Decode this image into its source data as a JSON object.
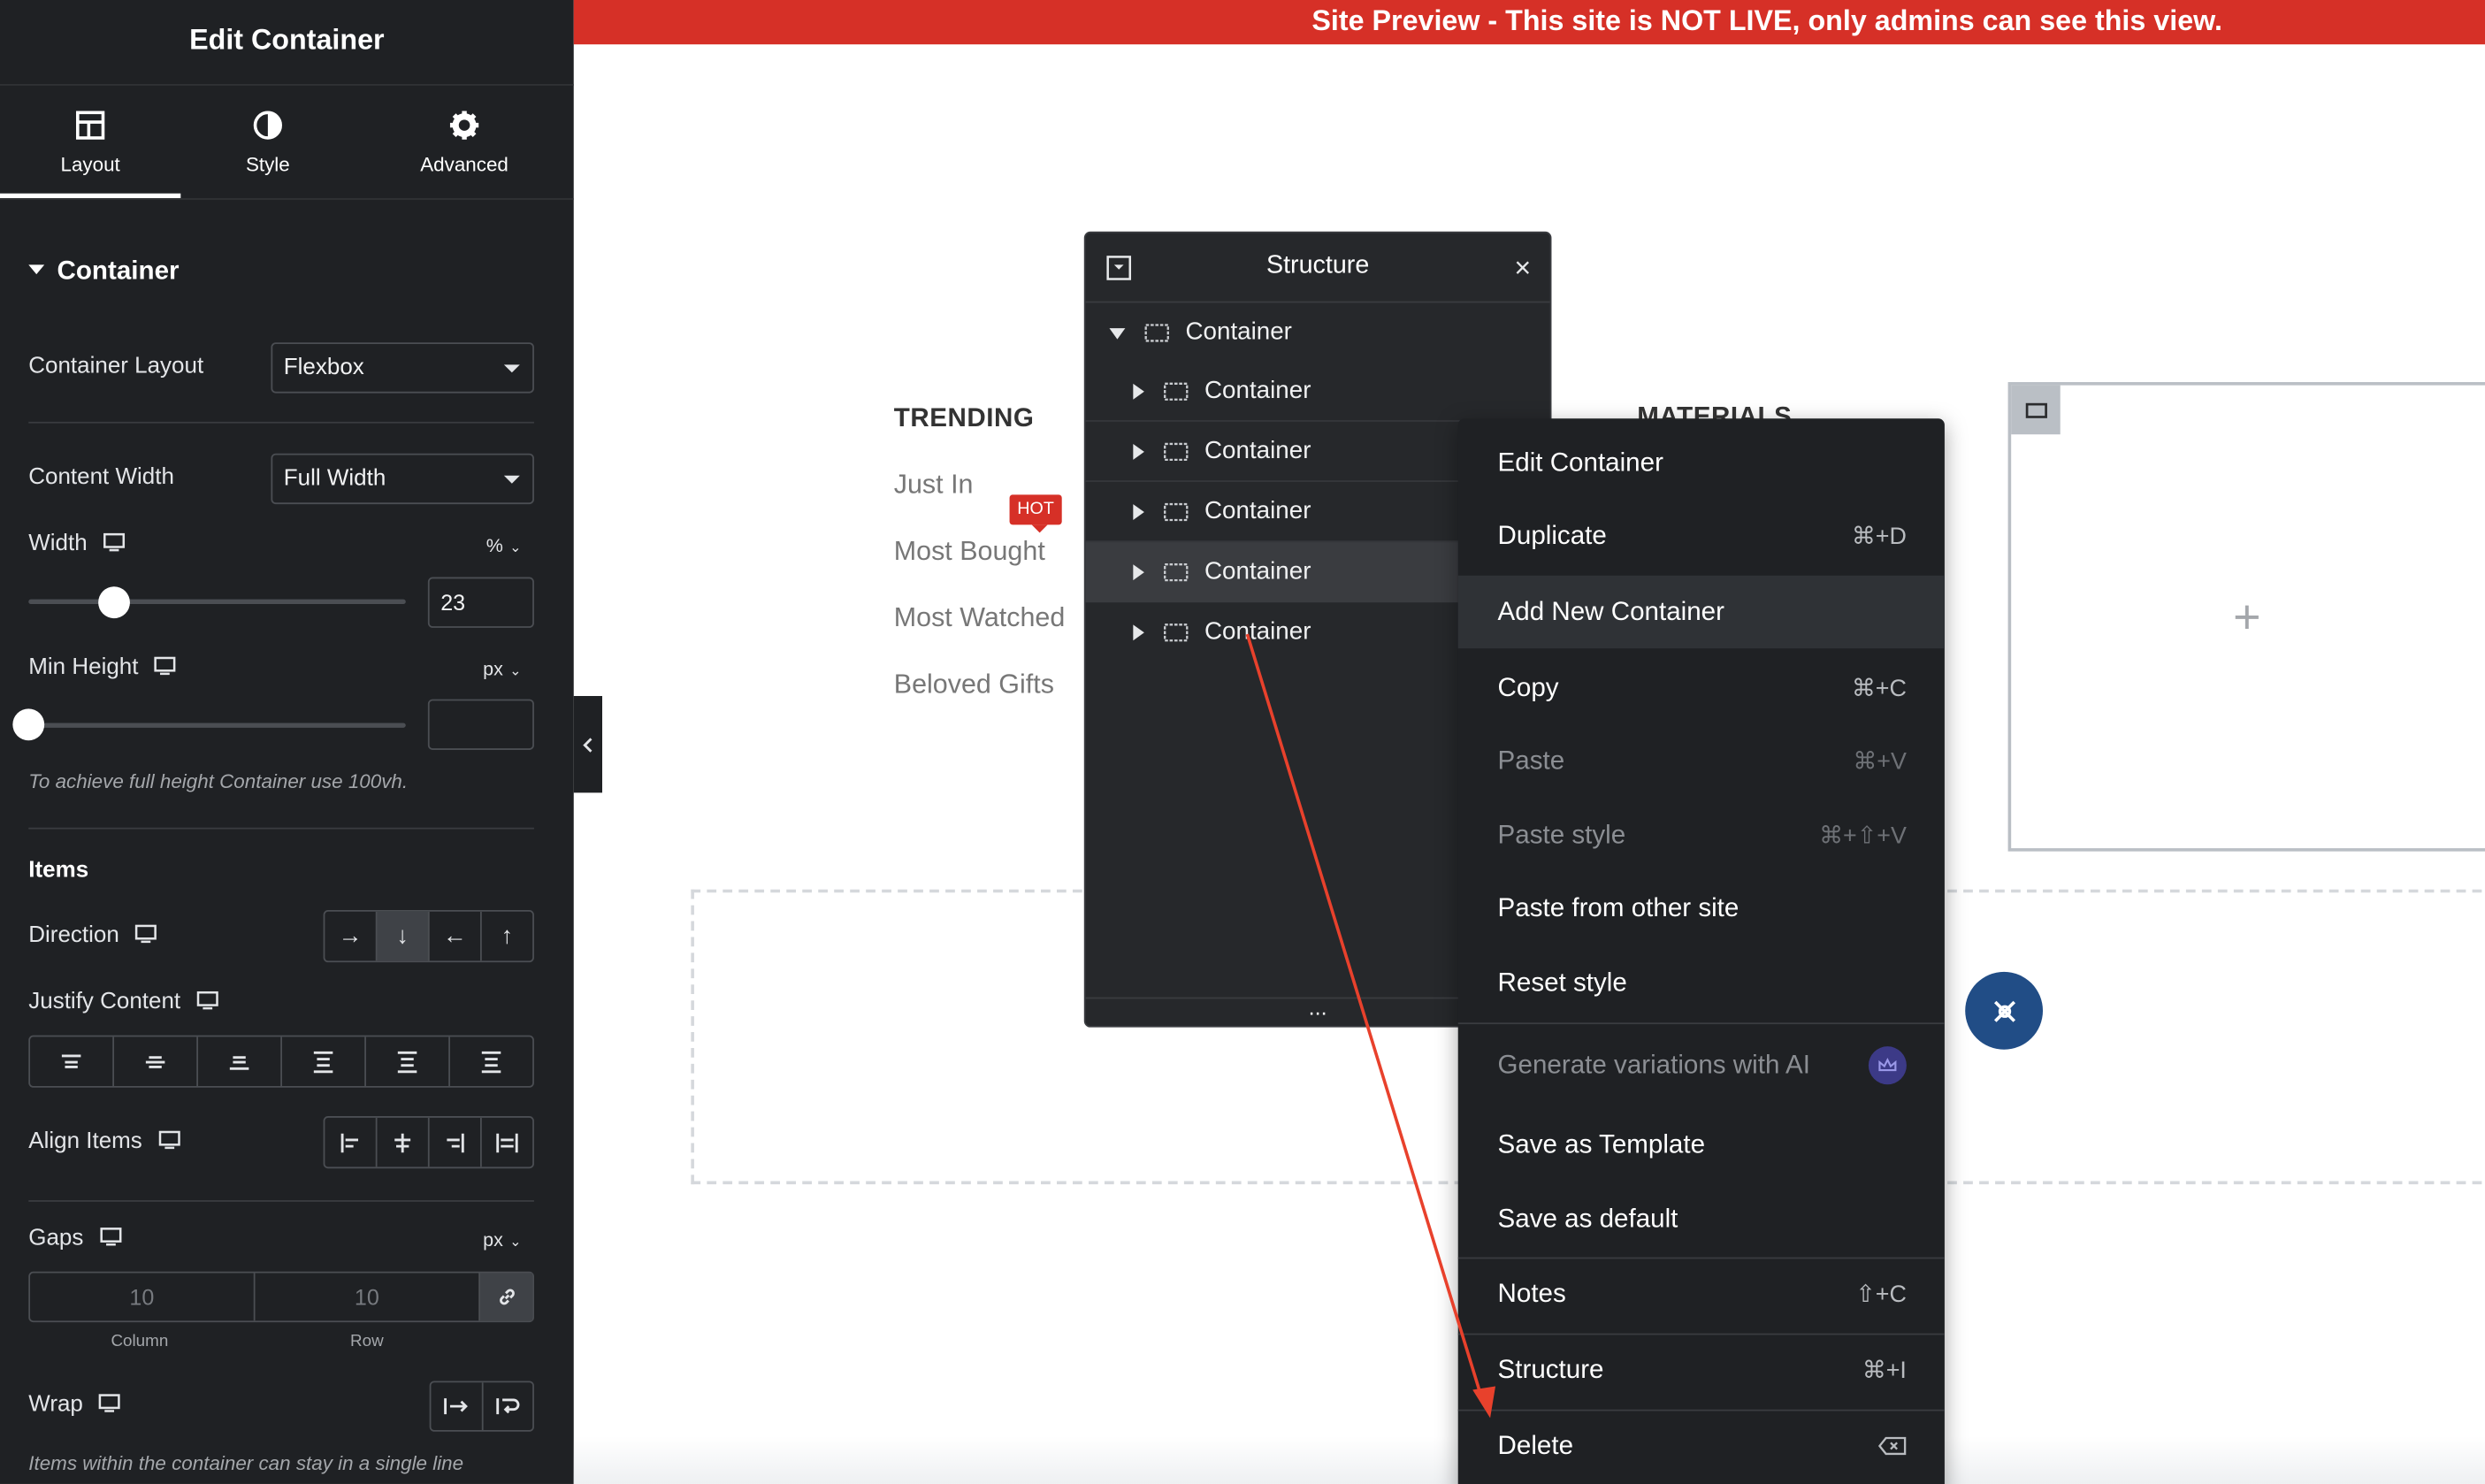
{
  "panel": {
    "title": "Edit Container",
    "tabs": [
      {
        "label": "Layout",
        "icon": "layout-icon",
        "active": true
      },
      {
        "label": "Style",
        "icon": "half-circle-icon"
      },
      {
        "label": "Advanced",
        "icon": "gear-icon"
      }
    ],
    "section": "Container",
    "container_layout": {
      "label": "Container Layout",
      "value": "Flexbox"
    },
    "content_width": {
      "label": "Content Width",
      "value": "Full Width"
    },
    "width": {
      "label": "Width",
      "unit": "%",
      "value": "23"
    },
    "min_height": {
      "label": "Min Height",
      "unit": "px",
      "value": "",
      "hint": "To achieve full height Container use 100vh."
    },
    "items_heading": "Items",
    "direction": {
      "label": "Direction",
      "active_index": 1
    },
    "justify_content": {
      "label": "Justify Content"
    },
    "align_items": {
      "label": "Align Items"
    },
    "gaps": {
      "label": "Gaps",
      "unit": "px",
      "column": "10",
      "row": "10",
      "column_label": "Column",
      "row_label": "Row"
    },
    "wrap": {
      "label": "Wrap",
      "hint": "Items within the container can stay in a single line"
    }
  },
  "preview": {
    "banner": "Site Preview - This site is NOT LIVE, only admins can see this view.",
    "menu_title": "TRENDING",
    "menu_title_2": "MATERIALS",
    "links": [
      "Just In",
      "Most Bought",
      "Most Watched",
      "Beloved Gifts"
    ],
    "hot_badge": "HOT",
    "plus": "+"
  },
  "structure": {
    "title": "Structure",
    "close": "×",
    "root": "Container",
    "children": [
      "Container",
      "Container",
      "Container",
      "Container",
      "Container"
    ],
    "highlighted_index": 3,
    "footer": "..."
  },
  "context_menu": {
    "items": [
      {
        "label": "Edit Container",
        "shortcut": ""
      },
      {
        "label": "Duplicate",
        "shortcut": "⌘+D"
      },
      {
        "label": "Add New Container",
        "shortcut": "",
        "highlighted": true
      },
      {
        "label": "Copy",
        "shortcut": "⌘+C"
      },
      {
        "label": "Paste",
        "shortcut": "⌘+V",
        "disabled": true
      },
      {
        "label": "Paste style",
        "shortcut": "⌘+⇧+V",
        "disabled": true
      },
      {
        "label": "Paste from other site",
        "shortcut": ""
      },
      {
        "label": "Reset style",
        "shortcut": ""
      },
      {
        "label": "Generate variations with AI",
        "shortcut": "",
        "disabled": true
      },
      {
        "label": "Save as Template",
        "shortcut": ""
      },
      {
        "label": "Save as default",
        "shortcut": ""
      },
      {
        "label": "Notes",
        "shortcut": "⇧+C"
      },
      {
        "label": "Structure",
        "shortcut": "⌘+I"
      },
      {
        "label": "Delete",
        "shortcut": ""
      }
    ]
  },
  "colors": {
    "panel_bg": "#1f2124",
    "banner_bg": "#d63027",
    "annotation_arrow": "#e8412c",
    "fab_bg": "#214d86"
  }
}
